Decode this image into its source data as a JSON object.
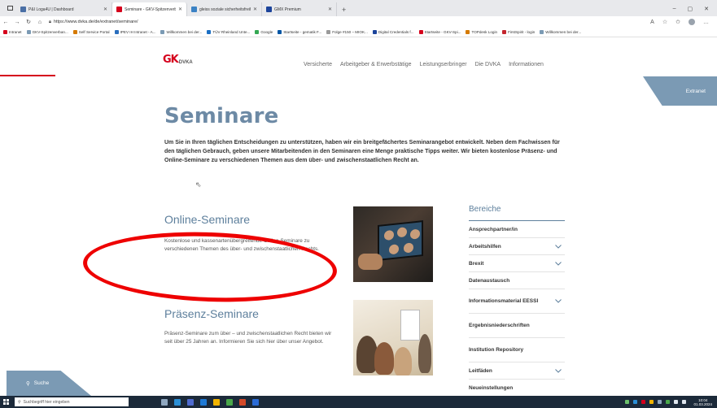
{
  "browser": {
    "tabs": [
      {
        "title": "P&I Loga4U | Dashboard",
        "active": false,
        "color": "#4a6fa5"
      },
      {
        "title": "Seminare - GKV-Spitzenverband",
        "active": true,
        "color": "#d5001c"
      },
      {
        "title": "gleiss soziale sicherheitsfreiheit",
        "active": false,
        "color": "#3b82c4"
      },
      {
        "title": "GMX Premium",
        "active": false,
        "color": "#1c449b"
      }
    ],
    "new_tab": "+",
    "window_controls": [
      "–",
      "▢",
      "✕"
    ],
    "url": "https://www.dvka.de/de/extranet/seminare/",
    "bookmarks": [
      {
        "label": "Intranet",
        "color": "#d5001c"
      },
      {
        "label": "GKV-Spitzenverban...",
        "color": "#7b9ab4"
      },
      {
        "label": "Self Service Portal",
        "color": "#d57a00"
      },
      {
        "label": "IPEV IH Intranet - A...",
        "color": "#2a6ebd"
      },
      {
        "label": "Willkommen bei der...",
        "color": "#7b9ab4"
      },
      {
        "label": "TÜV Rheinland Unte...",
        "color": "#1b6fc4"
      },
      {
        "label": "Google",
        "color": "#34a853"
      },
      {
        "label": "Startseite - gematik F...",
        "color": "#0055a4"
      },
      {
        "label": "Folge #150 – MIOK...",
        "color": "#9a9a9a"
      },
      {
        "label": "Digital Credentials f...",
        "color": "#1c449b"
      },
      {
        "label": "Startseite - GKV-Spi...",
        "color": "#d5001c"
      },
      {
        "label": "TOPdesk Login",
        "color": "#d57a00"
      },
      {
        "label": "FirstSpirit - login",
        "color": "#c4262e"
      },
      {
        "label": "Willkommen bei der...",
        "color": "#7b9ab4"
      }
    ]
  },
  "site": {
    "logo_mark": "GK",
    "logo_sub": "DVKA",
    "nav": [
      "Versicherte",
      "Arbeitgeber & Erwerbstätige",
      "Leistungserbringer",
      "Die DVKA",
      "Informationen"
    ],
    "extranet": "Extranet",
    "page_title": "Seminare",
    "intro": "Um Sie in Ihren täglichen Entscheidungen zu unterstützen, haben wir ein breitgefächertes Seminarangebot entwickelt. Neben dem Fachwissen für den täglichen Gebrauch, geben unsere Mitarbeitenden in den Seminaren eine Menge praktische Tipps weiter. Wir bieten kostenlose Präsenz- und Online-Seminare zu verschiedenen Themen aus dem über- und zwischenstaatlichen Recht an.",
    "sections": [
      {
        "title": "Online-Seminare",
        "text": "Kostenlose und kassenartenübergreifende Online-Seminare zu verschiedenen Themen des über- und zwischenstaatlichen Rechts."
      },
      {
        "title": "Präsenz-Seminare",
        "text": "Präsenz-Seminare zum über – und zwischenstaatlichen Recht bieten wir seit über 25 Jahren an. Informieren Sie sich hier über unser Angebot."
      }
    ],
    "sidebar_title": "Bereiche",
    "sidebar_items": [
      {
        "label": "Ansprechpartner/in",
        "has_chevron": false
      },
      {
        "label": "Arbeitshilfen",
        "has_chevron": true
      },
      {
        "label": "Brexit",
        "has_chevron": true
      },
      {
        "label": "Datenaustausch",
        "has_chevron": false
      },
      {
        "label": "Informationsmaterial EESSI",
        "has_chevron": true
      },
      {
        "label": "Ergebnisniederschriften",
        "has_chevron": false
      },
      {
        "label": "Institution Repository",
        "has_chevron": false
      },
      {
        "label": "Leitfäden",
        "has_chevron": true
      },
      {
        "label": "Neueinstellungen",
        "has_chevron": false
      }
    ],
    "search_label": "Suche",
    "accent_color": "#7b9ab4",
    "brand_red": "#d5001c"
  },
  "taskbar": {
    "search_placeholder": "Suchbegriff hier eingeben",
    "time": "10:04",
    "date": "01.03.2024"
  }
}
